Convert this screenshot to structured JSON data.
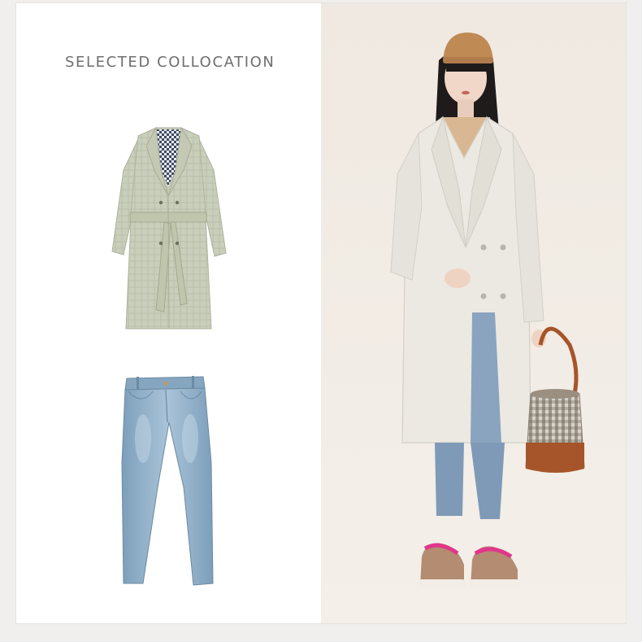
{
  "section_title": "SELECTED COLLOCATION",
  "products": [
    {
      "name": "plaid-trench-coat",
      "icon": "coat-image"
    },
    {
      "name": "skinny-jeans",
      "icon": "jeans-image"
    }
  ],
  "model_photo": {
    "icon": "model-photo"
  },
  "colors": {
    "background": "#ffffff",
    "photo_background": "#f1ece5",
    "title_text": "#6f6f6f",
    "coat_green": "#c8cdb8",
    "denim_blue": "#8fb0c9",
    "model_coat": "#ebe9e2",
    "bag_brown": "#a6552a"
  }
}
